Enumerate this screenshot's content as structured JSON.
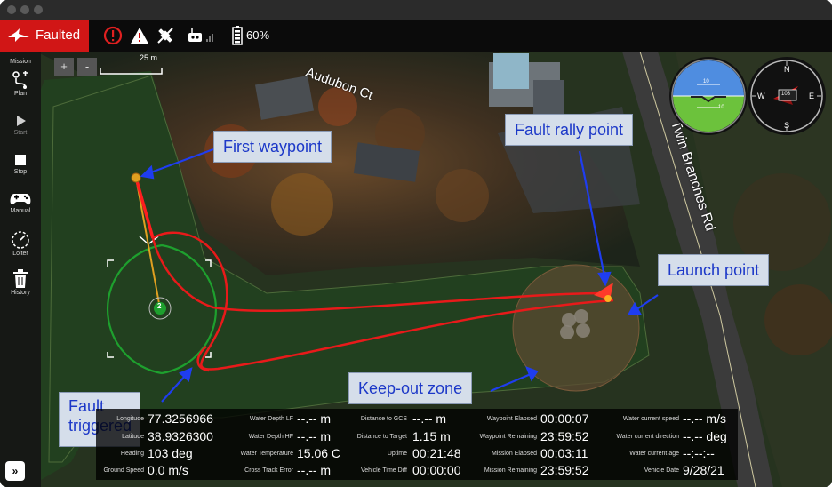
{
  "toolbar": {
    "status_label": "Faulted",
    "battery_percent": "60%"
  },
  "toolstrip": {
    "mission_label": "Mission",
    "items": [
      {
        "label": "Plan"
      },
      {
        "label": "Start"
      },
      {
        "label": "Stop"
      },
      {
        "label": "Manual"
      },
      {
        "label": "Loiter"
      },
      {
        "label": "History"
      }
    ]
  },
  "map": {
    "zoom_in": "+",
    "zoom_out": "-",
    "scale_label": "25 m",
    "street_audubon": "Audubon Ct",
    "street_twin": "Twin Branches Rd",
    "waypoint_number": "2"
  },
  "callouts": {
    "first_waypoint": "First waypoint",
    "fault_rally_point": "Fault rally point",
    "launch_point": "Launch point",
    "keep_out_zone": "Keep-out zone",
    "fault_triggered_line1": "Fault",
    "fault_triggered_line2": "triggered"
  },
  "instruments": {
    "attitude_top": "10",
    "attitude_bottom": "10",
    "compass_n": "N",
    "compass_e": "E",
    "compass_w": "W",
    "compass_s": "S",
    "heading": "103"
  },
  "telemetry": {
    "longitude": {
      "label": "Longitude",
      "value": "77.3256966"
    },
    "latitude": {
      "label": "Latitude",
      "value": "38.9326300"
    },
    "heading": {
      "label": "Heading",
      "value": "103 deg"
    },
    "ground_speed": {
      "label": "Ground Speed",
      "value": "0.0 m/s"
    },
    "water_depth_lf": {
      "label": "Water Depth LF",
      "value": "--.-- m"
    },
    "water_depth_hf": {
      "label": "Water Depth HF",
      "value": "--.-- m"
    },
    "water_temperature": {
      "label": "Water Temperature",
      "value": "15.06 C"
    },
    "cross_track_error": {
      "label": "Cross Track Error",
      "value": "--.-- m"
    },
    "distance_to_gcs": {
      "label": "Distance to GCS",
      "value": "--.-- m"
    },
    "distance_to_target": {
      "label": "Distance to Target",
      "value": "1.15 m"
    },
    "uptime": {
      "label": "Uptime",
      "value": "00:21:48"
    },
    "vehicle_time_diff": {
      "label": "Vehicle Time Diff",
      "value": "00:00:00"
    },
    "waypoint_elapsed": {
      "label": "Waypoint Elapsed",
      "value": "00:00:07"
    },
    "waypoint_remaining": {
      "label": "Waypoint Remaining",
      "value": "23:59:52"
    },
    "mission_elapsed": {
      "label": "Mission Elapsed",
      "value": "00:03:11"
    },
    "mission_remaining": {
      "label": "Mission Remaining",
      "value": "23:59:52"
    },
    "water_current_speed": {
      "label": "Water current speed",
      "value": "--.-- m/s"
    },
    "water_current_direction": {
      "label": "Water current direction",
      "value": "--.-- deg"
    },
    "water_current_age": {
      "label": "Water current age",
      "value": "--:--:--"
    },
    "vehicle_date": {
      "label": "Vehicle Date",
      "value": "9/28/21"
    }
  },
  "expand_button": "»"
}
